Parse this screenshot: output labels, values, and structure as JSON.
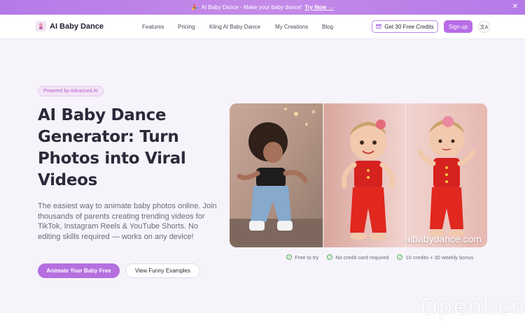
{
  "announcement": {
    "emoji": "🎉",
    "text": "AI Baby Dance - Make your baby dance!",
    "cta": "Try Now →",
    "close": "✕"
  },
  "nav": {
    "logo_text": "AI Baby Dance",
    "links": [
      "Features",
      "Pricing",
      "Kling AI Baby Dance",
      "My Creations",
      "Blog"
    ],
    "credits_label": "Get 30 Free Credits",
    "signup_label": "Sign up",
    "lang_icon": "文A"
  },
  "hero": {
    "badge": "Powered by Advanced AI",
    "title": "AI Baby Dance Generator: Turn Photos into Viral Videos",
    "description": "The easiest way to animate baby photos online. Join thousands of parents creating trending videos for TikTok, Instagram Reels & YouTube Shorts. No editing skills required — works on any device!",
    "primary_button": "Animate Your Baby Free",
    "secondary_button": "View Funny Examples",
    "image_watermark": "aibabydance.com",
    "features": [
      "Free to try",
      "No credit card required",
      "10 credits + 30 weekly bonus"
    ]
  },
  "watermark": "OpenI.cn",
  "colors": {
    "accent": "#b56fde",
    "announcement_bg": "#c08ae8",
    "check_green": "#4caf50"
  }
}
